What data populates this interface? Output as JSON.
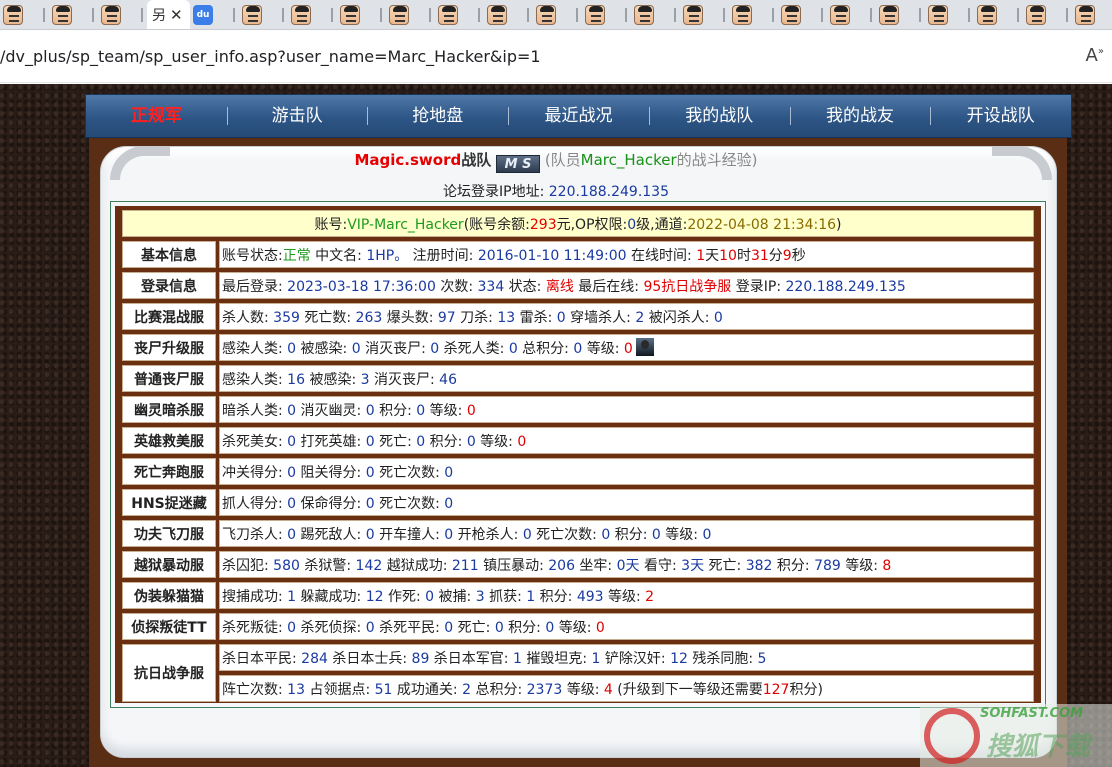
{
  "browser": {
    "tabs_icon_count": 23,
    "active_tab_glyph": "另",
    "url": "/dv_plus/sp_team/sp_user_info.asp?user_name=Marc_Hacker&ip=1"
  },
  "nav": {
    "items": [
      "正规军",
      "游击队",
      "抢地盘",
      "最近战况",
      "我的战队",
      "我的战友",
      "开设战队"
    ]
  },
  "team": {
    "name": "Magic.sword",
    "suffix": "战队",
    "logo": "M S",
    "member_prefix": "(队员",
    "member_name": "Marc_Hacker",
    "member_suffix": "的战斗经验)"
  },
  "ip": {
    "label": "论坛登录IP地址:",
    "value": "220.188.249.135"
  },
  "account": {
    "p1": "账号:",
    "id": "VIP-Marc_Hacker",
    "p2": "(账号余额:",
    "balance": "293",
    "p3": "元,OP权限:",
    "op": "0",
    "p4": "级,通道:",
    "time": "2022-04-08 21:34:16",
    "p5": ")"
  },
  "rows": {
    "basic": {
      "label": "基本信息",
      "t1": "账号状态:",
      "status": "正常",
      "t2": " 中文名: ",
      "cn_name": "1HP。",
      "t3": " 注册时间: ",
      "reg": "2016-01-10 11:49:00",
      "t4": " 在线时间: ",
      "d": "1",
      "t5": "天",
      "h": "10",
      "t6": "时",
      "m": "31",
      "t7": "分",
      "s": "9",
      "t8": "秒"
    },
    "login": {
      "label": "登录信息",
      "t1": "最后登录: ",
      "last": "2023-03-18 17:36:00",
      "t2": " 次数: ",
      "count": "334",
      "t3": " 状态: ",
      "state": "离线",
      "t4": " 最后在线: ",
      "server": "95抗日战争服",
      "t5": " 登录IP: ",
      "ip": "220.188.249.135"
    },
    "mix": {
      "label": "比赛混战服",
      "t1": "杀人数: ",
      "v1": "359",
      "t2": " 死亡数: ",
      "v2": "263",
      "t3": " 爆头数: ",
      "v3": "97",
      "t4": " 刀杀: ",
      "v4": "13",
      "t5": " 雷杀: ",
      "v5": "0",
      "t6": " 穿墙杀人: ",
      "v6": "2",
      "t7": " 被闪杀人: ",
      "v7": "0"
    },
    "zombie_up": {
      "label": "丧尸升级服",
      "t1": "感染人类: ",
      "v1": "0",
      "t2": " 被感染: ",
      "v2": "0",
      "t3": " 消灭丧尸: ",
      "v3": "0",
      "t4": " 杀死人类: ",
      "v4": "0",
      "t5": " 总积分: ",
      "v5": "0",
      "t6": " 等级: ",
      "v6": "0"
    },
    "zombie": {
      "label": "普通丧尸服",
      "t1": "感染人类: ",
      "v1": "16",
      "t2": " 被感染: ",
      "v2": "3",
      "t3": " 消灭丧尸: ",
      "v3": "46"
    },
    "ghost": {
      "label": "幽灵暗杀服",
      "t1": "暗杀人类: ",
      "v1": "0",
      "t2": " 消灭幽灵: ",
      "v2": "0",
      "t3": " 积分: ",
      "v3": "0",
      "t4": " 等级: ",
      "v4": "0"
    },
    "hero": {
      "label": "英雄救美服",
      "t1": "杀死美女: ",
      "v1": "0",
      "t2": " 打死英雄: ",
      "v2": "0",
      "t3": " 死亡: ",
      "v3": "0",
      "t4": " 积分: ",
      "v4": "0",
      "t5": " 等级: ",
      "v5": "0"
    },
    "deathrun": {
      "label": "死亡奔跑服",
      "t1": "冲关得分: ",
      "v1": "0",
      "t2": " 阻关得分: ",
      "v2": "0",
      "t3": " 死亡次数: ",
      "v3": "0"
    },
    "hns": {
      "label": "HNS捉迷藏",
      "t1": "抓人得分: ",
      "v1": "0",
      "t2": " 保命得分: ",
      "v2": "0",
      "t3": " 死亡次数: ",
      "v3": "0"
    },
    "kungfu": {
      "label": "功夫飞刀服",
      "t1": "飞刀杀人: ",
      "v1": "0",
      "t2": " 踢死敌人: ",
      "v2": "0",
      "t3": " 开车撞人: ",
      "v3": "0",
      "t4": " 开枪杀人: ",
      "v4": "0",
      "t5": " 死亡次数: ",
      "v5": "0",
      "t6": " 积分: ",
      "v6": "0",
      "t7": " 等级: ",
      "v7": "0"
    },
    "jail": {
      "label": "越狱暴动服",
      "t1": "杀囚犯: ",
      "v1": "580",
      "t2": " 杀狱警: ",
      "v2": "142",
      "t3": " 越狱成功: ",
      "v3": "211",
      "t4": " 镇压暴动: ",
      "v4": "206",
      "t5": " 坐牢: ",
      "v5": "0天",
      "t6": " 看守: ",
      "v6": "3天",
      "t7": " 死亡: ",
      "v7": "382",
      "t8": " 积分: ",
      "v8": "789",
      "t9": " 等级: ",
      "v9": "8"
    },
    "prop": {
      "label": "伪装躲猫猫",
      "t1": "搜捕成功: ",
      "v1": "1",
      "t2": " 躲藏成功: ",
      "v2": "12",
      "t3": " 作死: ",
      "v3": "0",
      "t4": " 被捕: ",
      "v4": "3",
      "t5": " 抓获: ",
      "v5": "1",
      "t6": " 积分: ",
      "v6": "493",
      "t7": " 等级: ",
      "v7": "2"
    },
    "ttt": {
      "label": "侦探叛徒TT",
      "t1": "杀死叛徒: ",
      "v1": "0",
      "t2": " 杀死侦探: ",
      "v2": "0",
      "t3": " 杀死平民: ",
      "v3": "0",
      "t4": " 死亡: ",
      "v4": "0",
      "t5": " 积分: ",
      "v5": "0",
      "t6": " 等级: ",
      "v6": "0"
    },
    "war": {
      "label": "抗日战争服",
      "a1": "杀日本平民: ",
      "av1": "284",
      "a2": " 杀日本士兵: ",
      "av2": "89",
      "a3": " 杀日本军官: ",
      "av3": "1",
      "a4": " 摧毁坦克: ",
      "av4": "1",
      "a5": " 铲除汉奸: ",
      "av5": "12",
      "a6": " 残杀同胞: ",
      "av6": "5",
      "b1": "阵亡次数: ",
      "bv1": "13",
      "b2": " 占领据点: ",
      "bv2": "51",
      "b3": " 成功通关: ",
      "bv3": "2",
      "b4": " 总积分: ",
      "bv4": "2373",
      "b5": " 等级: ",
      "bv5": "4",
      "b6": " (升级到下一等级还需要",
      "bv6": "127",
      "b7": "积分)"
    }
  },
  "watermark": {
    "line1": "SOHFAST.COM",
    "line2": "搜狐下载"
  }
}
